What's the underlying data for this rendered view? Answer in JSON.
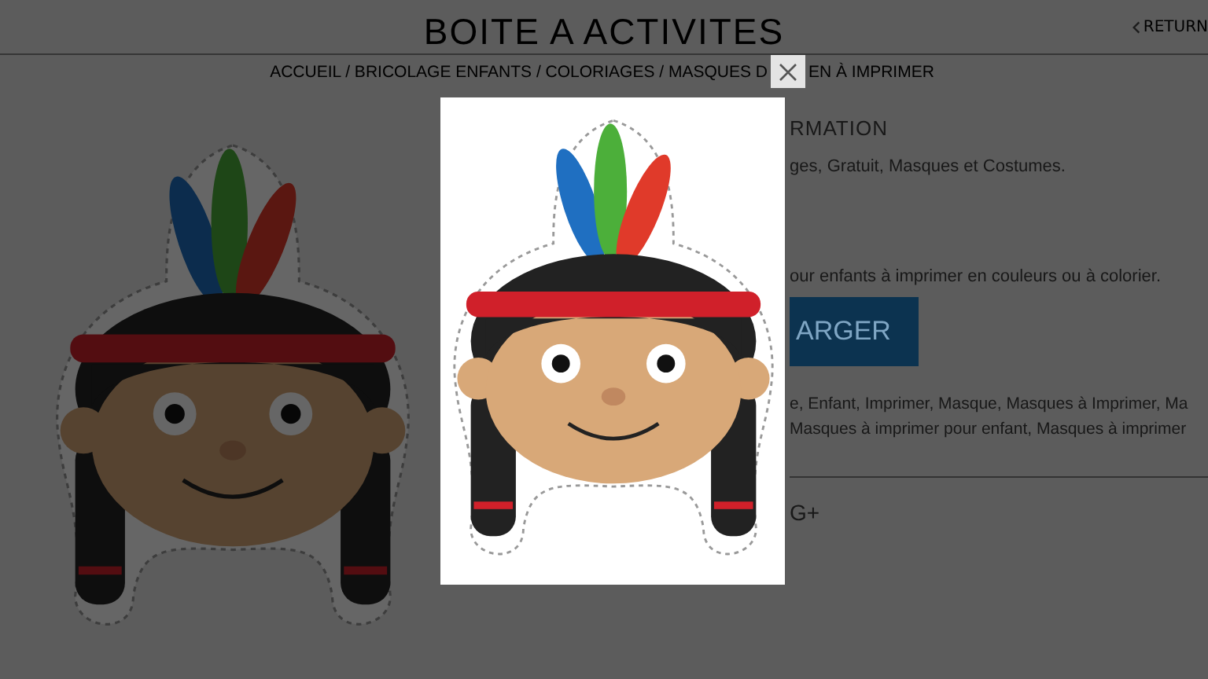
{
  "header": {
    "title": "BOITE A ACTIVITES",
    "return_link": "RETURN"
  },
  "breadcrumb": [
    "ACCUEIL / BRICOLAGE ENFANTS / COLORIAGES / MASQUES D",
    "EN À IMPRIMER"
  ],
  "info": {
    "heading": "RMATION",
    "categories": "ges, Gratuit, Masques et Costumes.",
    "description": "our enfants à imprimer en couleurs ou à colorier.",
    "download_button": "ARGER",
    "tags": [
      "e, Enfant, Imprimer, Masque, Masques à Imprimer, Ma",
      "Masques à imprimer pour enfant, Masques à imprimer"
    ],
    "share": "G+"
  }
}
